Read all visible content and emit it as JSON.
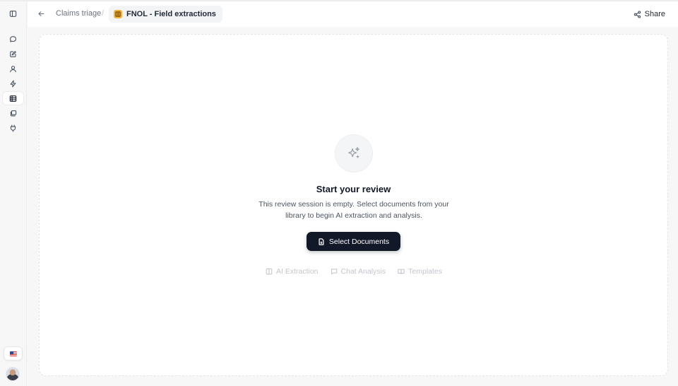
{
  "sidebar": {
    "items": [
      {
        "name": "panel-toggle",
        "icon": "sidebar-panel-icon"
      },
      {
        "name": "chat",
        "icon": "chat-bubble-icon"
      },
      {
        "name": "edit",
        "icon": "edit-icon"
      },
      {
        "name": "user",
        "icon": "user-icon"
      },
      {
        "name": "automations",
        "icon": "lightning-icon"
      },
      {
        "name": "review-table",
        "icon": "table-icon",
        "active": true
      },
      {
        "name": "library",
        "icon": "stack-icon"
      },
      {
        "name": "integrations",
        "icon": "plug-icon"
      }
    ],
    "language_flag": "us-flag-icon",
    "avatar": "user-avatar"
  },
  "header": {
    "breadcrumb_parent": "Claims triage",
    "breadcrumb_separator": "/",
    "breadcrumb_current": "FNOL - Field extractions",
    "share_label": "Share"
  },
  "empty_state": {
    "title": "Start your review",
    "description": "This review session is empty. Select documents from your library to begin AI extraction and analysis.",
    "button_label": "Select Documents",
    "features": [
      {
        "label": "AI Extraction",
        "icon": "columns-icon"
      },
      {
        "label": "Chat Analysis",
        "icon": "chat-bubble-icon"
      },
      {
        "label": "Templates",
        "icon": "book-icon"
      }
    ]
  },
  "colors": {
    "primary_button": "#111827",
    "accent_icon": "#f5b43b",
    "background": "#f7f7f8"
  }
}
